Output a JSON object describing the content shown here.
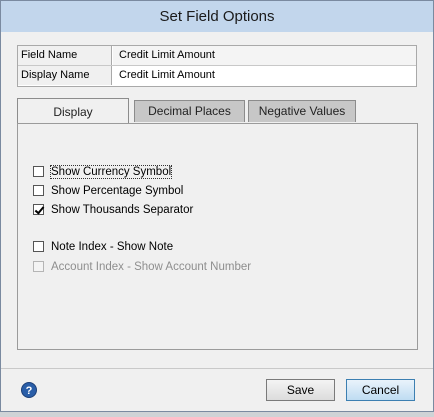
{
  "dialog": {
    "title": "Set Field Options"
  },
  "fields": {
    "field_name_label": "Field Name",
    "field_name_value": "Credit Limit Amount",
    "display_name_label": "Display Name",
    "display_name_value": "Credit Limit Amount"
  },
  "tabs": [
    {
      "label": "Display",
      "active": true
    },
    {
      "label": "Decimal Places",
      "active": false
    },
    {
      "label": "Negative Values",
      "active": false
    }
  ],
  "options": [
    {
      "label": "Show Currency Symbol",
      "checked": false,
      "enabled": true,
      "focused": true
    },
    {
      "label": "Show Percentage Symbol",
      "checked": false,
      "enabled": true
    },
    {
      "label": "Show Thousands Separator",
      "checked": true,
      "enabled": true
    },
    {
      "label": "Note Index - Show Note",
      "checked": false,
      "enabled": true
    },
    {
      "label": "Account Index - Show Account Number",
      "checked": false,
      "enabled": false
    }
  ],
  "buttons": {
    "save": "Save",
    "cancel": "Cancel"
  },
  "help_icon": "question-mark-icon"
}
